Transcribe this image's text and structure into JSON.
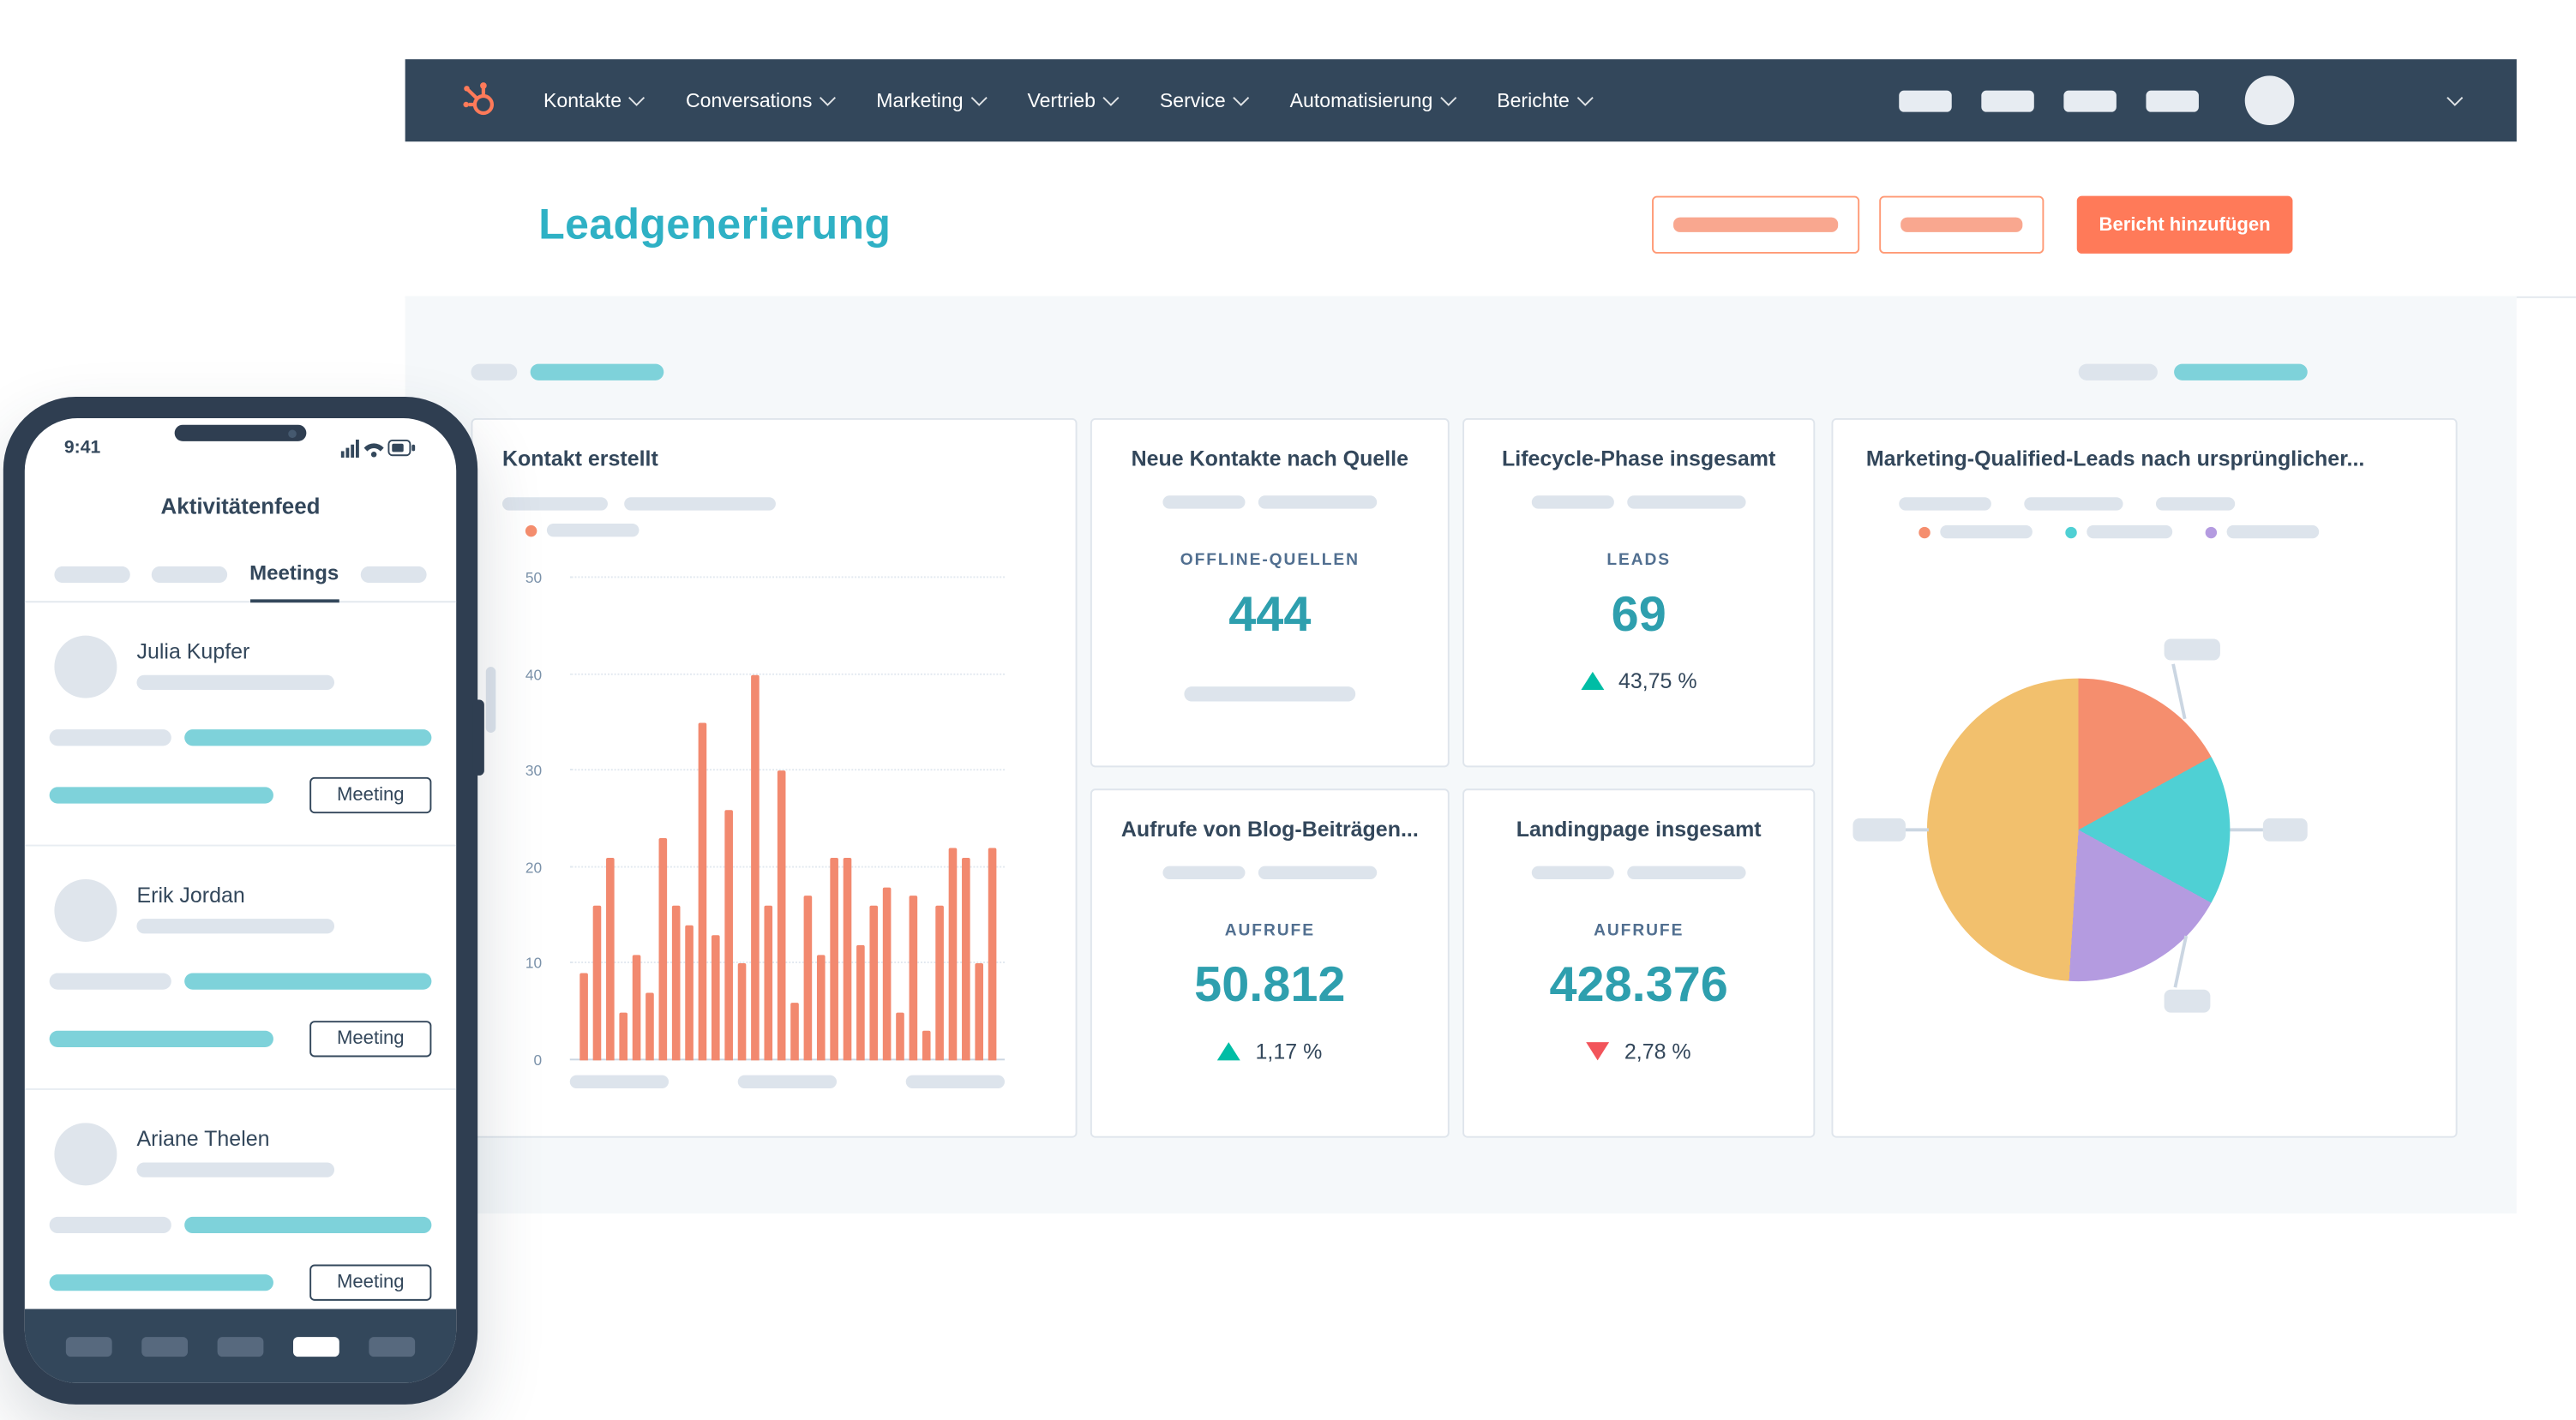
{
  "nav": {
    "items": [
      "Kontakte",
      "Conversations",
      "Marketing",
      "Vertrieb",
      "Service",
      "Automatisierung",
      "Berichte"
    ]
  },
  "header": {
    "title": "Leadgenerierung",
    "add_report_label": "Bericht hinzufügen"
  },
  "cards": {
    "kontakt_erstellt": {
      "title": "Kontakt erstellt"
    },
    "neue_kontakte": {
      "title": "Neue Kontakte nach Quelle",
      "metric_label": "OFFLINE-QUELLEN",
      "value": "444"
    },
    "lifecycle": {
      "title": "Lifecycle-Phase insgesamt",
      "metric_label": "LEADS",
      "value": "69",
      "delta": "43,75 %",
      "delta_direction": "up"
    },
    "mql": {
      "title": "Marketing-Qualified-Leads nach ursprünglicher..."
    },
    "blog": {
      "title": "Aufrufe von Blog-Beiträgen...",
      "metric_label": "AUFRUFE",
      "value": "50.812",
      "delta": "1,17 %",
      "delta_direction": "up"
    },
    "landingpage": {
      "title": "Landingpage insgesamt",
      "metric_label": "AUFRUFE",
      "value": "428.376",
      "delta": "2,78 %",
      "delta_direction": "down"
    }
  },
  "chart_data": [
    {
      "type": "bar",
      "title": "Kontakt erstellt",
      "values": [
        9,
        16,
        21,
        5,
        11,
        7,
        23,
        16,
        14,
        35,
        13,
        26,
        10,
        40,
        16,
        30,
        6,
        17,
        11,
        21,
        21,
        12,
        16,
        18,
        5,
        17,
        3,
        16,
        22,
        21,
        10,
        22
      ],
      "ylim": [
        0,
        50
      ],
      "yticks": [
        0,
        10,
        20,
        30,
        40,
        50
      ],
      "bar_color": "#f2896f",
      "grid": "dotted-horizontal",
      "legend_position": "top-left"
    },
    {
      "type": "pie",
      "title": "Marketing-Qualified-Leads nach ursprünglicher Quelle",
      "segments": [
        {
          "name": "segment-1",
          "color": "#f58e6e",
          "percent": 17
        },
        {
          "name": "segment-2",
          "color": "#4fd0d4",
          "percent": 16
        },
        {
          "name": "segment-3",
          "color": "#b49be0",
          "percent": 18
        },
        {
          "name": "segment-4",
          "color": "#f2c06d",
          "percent": 49
        }
      ],
      "start_angle_deg": 0,
      "legend_position": "top-left"
    }
  ],
  "phone": {
    "status_time": "9:41",
    "title": "Aktivitätenfeed",
    "active_tab": "Meetings",
    "feed": [
      {
        "name": "Julia Kupfer",
        "action": "Meeting"
      },
      {
        "name": "Erik Jordan",
        "action": "Meeting"
      },
      {
        "name": "Ariane Thelen",
        "action": "Meeting"
      }
    ]
  },
  "colors": {
    "navy": "#33475b",
    "teal_title": "#2fb1c5",
    "teal_text": "#2e9fae",
    "orange": "#ff7a59",
    "orange_pill": "#f9a78f",
    "bar": "#f2896f",
    "positive": "#00bda5",
    "negative": "#f2545b",
    "ph_gray": "#dde4ec",
    "ph_teal": "#7ed2da",
    "card_border": "#dfe5ec",
    "dash_bg": "#f5f8fa",
    "muted": "#516f90"
  }
}
